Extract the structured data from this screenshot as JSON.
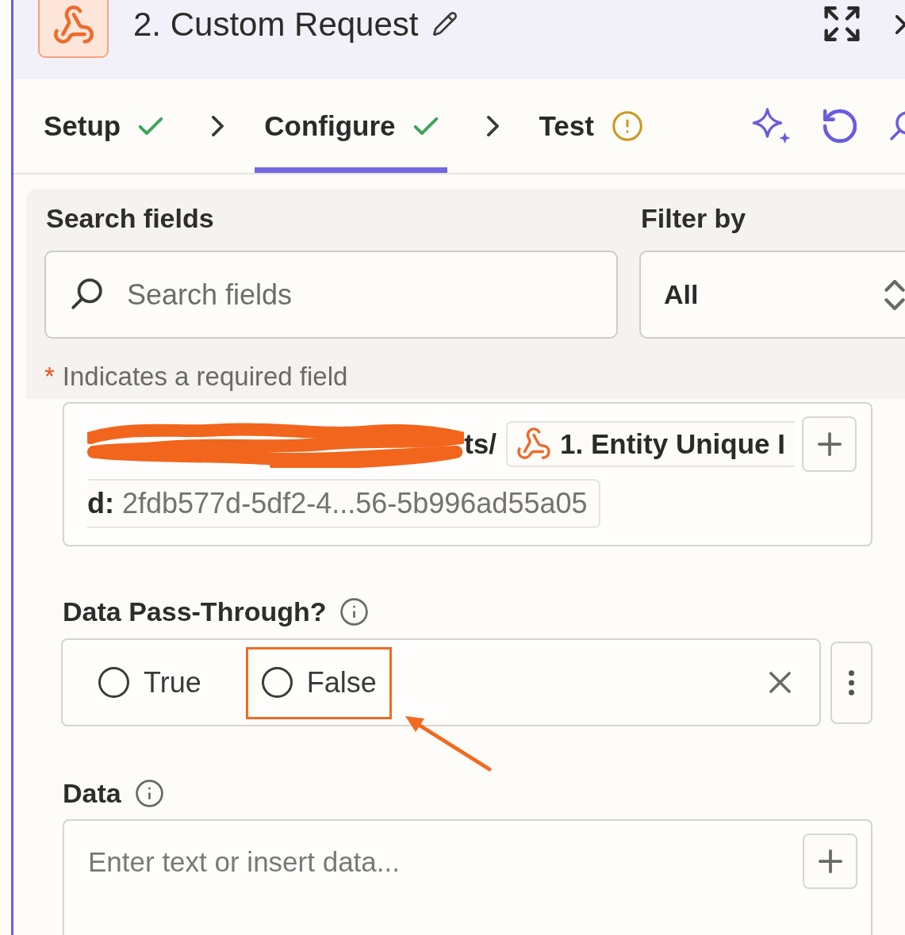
{
  "header": {
    "title": "2. Custom Request"
  },
  "tabs": [
    {
      "label": "Setup",
      "selected": false,
      "complete": true
    },
    {
      "label": "Configure",
      "selected": true,
      "complete": true
    },
    {
      "label": "Test",
      "selected": false,
      "complete": false
    }
  ],
  "search": {
    "label": "Search fields",
    "placeholder": "Search fields"
  },
  "filter": {
    "label": "Filter by",
    "value": "All"
  },
  "required_note": {
    "marker": "*",
    "text": "Indicates a required field"
  },
  "url_field": {
    "redacted": true,
    "visible_text": "ts/",
    "pill": {
      "line_1": "1. Entity Unique I",
      "line_2_label": "d:",
      "line_2_value": "2fdb577d-5df2-4...56-5b996ad55a05"
    }
  },
  "pass_through": {
    "label": "Data Pass-Through?",
    "options": [
      {
        "label": "True",
        "selected": false,
        "highlighted": false
      },
      {
        "label": "False",
        "selected": false,
        "highlighted": true
      }
    ]
  },
  "data_field": {
    "label": "Data",
    "placeholder": "Enter text or insert data..."
  }
}
